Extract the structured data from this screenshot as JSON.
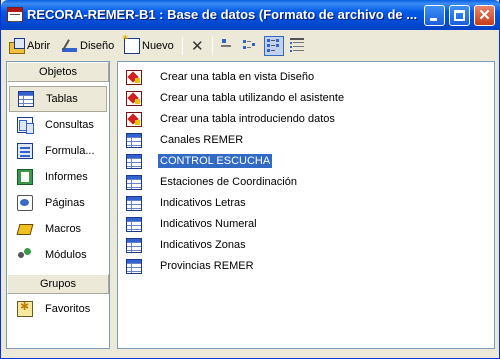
{
  "window": {
    "title": "RECORA-REMER-B1 : Base de datos (Formato de archivo de ...",
    "controls": {
      "minimize": "minimize",
      "maximize": "maximize",
      "close": "✕"
    }
  },
  "toolbar": {
    "open_label": "Abrir",
    "design_label": "Diseño",
    "new_label": "Nuevo",
    "view_icons": [
      "large-icons-view",
      "small-icons-view",
      "list-view",
      "details-view"
    ],
    "active_view": "list-view"
  },
  "sidebar": {
    "objects_header": "Objetos",
    "items": [
      {
        "label": "Tablas",
        "icon": "table-icon"
      },
      {
        "label": "Consultas",
        "icon": "query-icon"
      },
      {
        "label": "Formula...",
        "icon": "form-icon"
      },
      {
        "label": "Informes",
        "icon": "report-icon"
      },
      {
        "label": "Páginas",
        "icon": "page-icon"
      },
      {
        "label": "Macros",
        "icon": "macro-icon"
      },
      {
        "label": "Módulos",
        "icon": "module-icon"
      }
    ],
    "groups_header": "Grupos",
    "groups": [
      {
        "label": "Favoritos",
        "icon": "favorites-icon"
      }
    ],
    "selected": "Tablas"
  },
  "objects_list": {
    "items": [
      {
        "label": "Crear una tabla en vista Diseño",
        "icon": "wizard-icon"
      },
      {
        "label": "Crear una tabla utilizando el asistente",
        "icon": "wizard-icon"
      },
      {
        "label": "Crear una tabla introduciendo datos",
        "icon": "wizard-icon"
      },
      {
        "label": "Canales REMER",
        "icon": "table-icon"
      },
      {
        "label": "CONTROL ESCUCHA",
        "icon": "table-icon"
      },
      {
        "label": "Estaciones de Coordinación",
        "icon": "table-icon"
      },
      {
        "label": "Indicativos Letras",
        "icon": "table-icon"
      },
      {
        "label": "Indicativos Numeral",
        "icon": "table-icon"
      },
      {
        "label": "Indicativos Zonas",
        "icon": "table-icon"
      },
      {
        "label": "Provincias REMER",
        "icon": "table-icon"
      }
    ],
    "selected": "CONTROL ESCUCHA"
  },
  "colors": {
    "titlebar": "#0058e6",
    "selection": "#316ac5",
    "window_bg": "#ece9d8",
    "pane_border": "#7f9db9"
  }
}
